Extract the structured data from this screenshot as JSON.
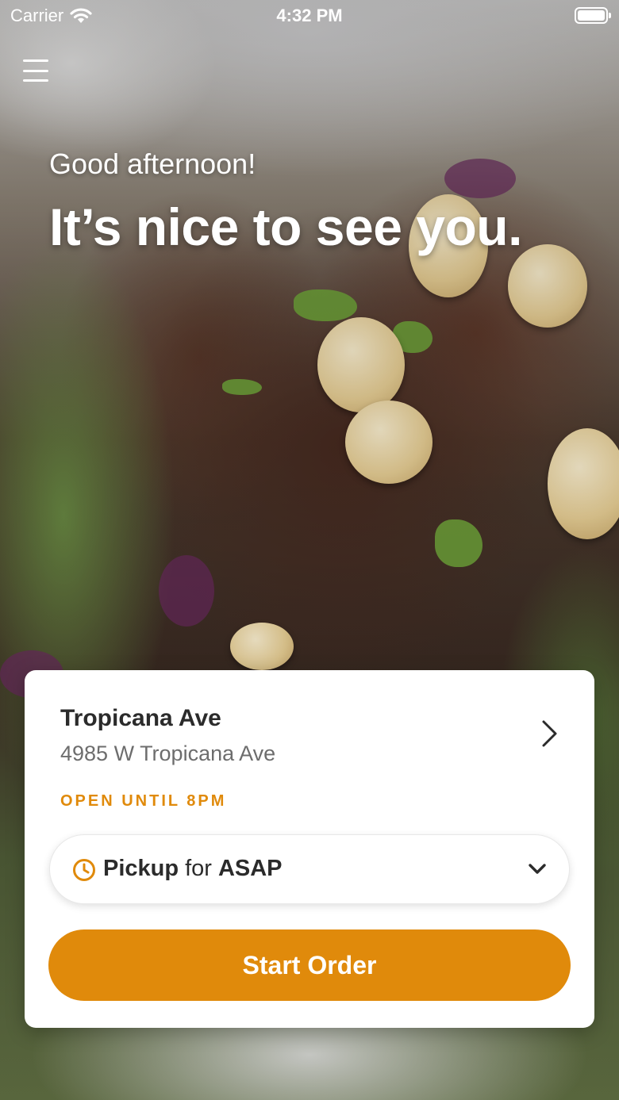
{
  "status_bar": {
    "carrier": "Carrier",
    "time": "4:32 PM"
  },
  "greeting": {
    "subtitle": "Good afternoon!",
    "title": "It’s nice to see you."
  },
  "location": {
    "name": "Tropicana Ave",
    "address": "4985 W Tropicana Ave",
    "hours_status": "OPEN UNTIL 8PM"
  },
  "order_mode": {
    "method": "Pickup",
    "connector": "for",
    "time": "ASAP"
  },
  "actions": {
    "start_order_label": "Start Order"
  },
  "icons": {
    "menu": "hamburger-menu-icon",
    "wifi": "wifi-icon",
    "battery": "battery-icon",
    "store_chevron": "chevron-right-icon",
    "clock": "clock-icon",
    "dropdown": "chevron-down-icon"
  },
  "colors": {
    "accent": "#e08a0b",
    "card_background": "#ffffff",
    "text_primary": "#2b2b2b",
    "text_secondary": "#6d6d6d"
  }
}
